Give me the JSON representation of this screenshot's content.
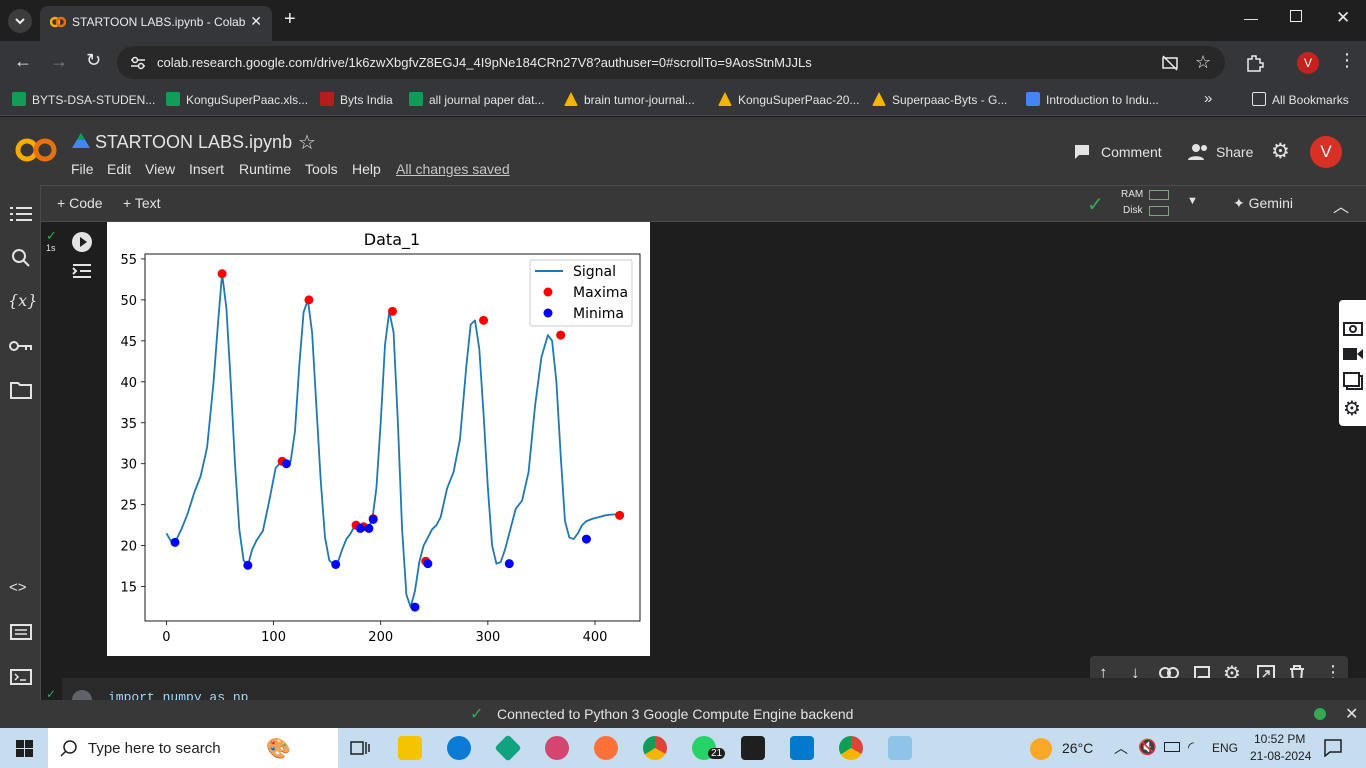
{
  "browser": {
    "tab_title": "STARTOON LABS.ipynb - Colab",
    "url": "colab.research.google.com/drive/1k6zwXbgfvZ8EGJ4_4I9pNe184CRn27V8?authuser=0#scrollTo=9AosStnMJJLs",
    "profile_initial": "V",
    "bookmarks": [
      {
        "label": "BYTS-DSA-STUDEN...",
        "color": "#0f9d58"
      },
      {
        "label": "KonguSuperPaac.xls...",
        "color": "#0f9d58"
      },
      {
        "label": "Byts India",
        "color": "#b71c1c"
      },
      {
        "label": "all journal paper dat...",
        "color": "#0f9d58"
      },
      {
        "label": "brain tumor-journal...",
        "color": "#f4b400"
      },
      {
        "label": "KonguSuperPaac-20...",
        "color": "#f4b400"
      },
      {
        "label": "Superpaac-Byts - G...",
        "color": "#f4b400"
      },
      {
        "label": "Introduction to Indu...",
        "color": "#4285f4"
      }
    ],
    "all_bookmarks": "All Bookmarks"
  },
  "colab": {
    "notebook_title": "STARTOON LABS.ipynb",
    "menu": [
      "File",
      "Edit",
      "View",
      "Insert",
      "Runtime",
      "Tools",
      "Help"
    ],
    "saved_status": "All changes saved",
    "comment": "Comment",
    "share": "Share",
    "avatar_initial": "V",
    "toolbar": {
      "code": "Code",
      "text": "Text",
      "ram": "RAM",
      "disk": "Disk",
      "gemini": "Gemini"
    },
    "cell_exec_time": "1s",
    "next_cell_code": "import numpy as np",
    "status_text": "Connected to Python 3 Google Compute Engine backend"
  },
  "chart_data": {
    "type": "line",
    "title": "Data_1",
    "xlabel": "",
    "ylabel": "",
    "xlim": [
      -20,
      442
    ],
    "ylim": [
      10.8,
      55.6
    ],
    "xticks": [
      0,
      100,
      200,
      300,
      400
    ],
    "yticks": [
      15,
      20,
      25,
      30,
      35,
      40,
      45,
      50,
      55
    ],
    "legend_position": "top-right",
    "series": [
      {
        "name": "Signal",
        "color": "#1f77b4",
        "kind": "line",
        "x": [
          0,
          4,
          8,
          14,
          20,
          26,
          32,
          38,
          44,
          48,
          52,
          56,
          60,
          64,
          68,
          72,
          76,
          80,
          84,
          90,
          96,
          102,
          108,
          112,
          116,
          120,
          124,
          128,
          132,
          136,
          140,
          144,
          148,
          152,
          156,
          160,
          164,
          168,
          172,
          176,
          180,
          184,
          188,
          192,
          196,
          200,
          204,
          208,
          212,
          216,
          220,
          224,
          228,
          232,
          236,
          240,
          244,
          248,
          252,
          256,
          262,
          268,
          274,
          280,
          284,
          288,
          292,
          296,
          300,
          304,
          308,
          312,
          316,
          320,
          326,
          332,
          338,
          344,
          350,
          356,
          360,
          364,
          368,
          372,
          376,
          380,
          384,
          388,
          392,
          398,
          404,
          410,
          416,
          422
        ],
        "y": [
          21.5,
          20.6,
          20.4,
          22.0,
          24.0,
          26.5,
          28.5,
          32.0,
          40.0,
          47.0,
          53.2,
          49.0,
          40.0,
          30.0,
          22.0,
          18.2,
          17.6,
          19.5,
          20.6,
          21.8,
          25.5,
          29.5,
          30.3,
          30.1,
          30.3,
          34.0,
          42.0,
          48.5,
          50.0,
          46.0,
          37.0,
          28.0,
          21.0,
          18.2,
          17.7,
          18.0,
          19.5,
          20.8,
          21.5,
          22.5,
          22.3,
          22.2,
          22.2,
          23.0,
          27.0,
          35.0,
          44.5,
          48.6,
          46.0,
          35.0,
          22.0,
          14.0,
          12.5,
          14.5,
          18.0,
          20.0,
          21.0,
          22.0,
          22.5,
          23.5,
          27.0,
          29.0,
          33.0,
          42.0,
          47.0,
          47.5,
          44.0,
          36.0,
          27.0,
          20.0,
          17.8,
          18.0,
          19.5,
          21.5,
          24.5,
          25.5,
          29.0,
          37.0,
          43.0,
          45.7,
          45.0,
          40.0,
          31.0,
          23.0,
          21.0,
          20.8,
          21.5,
          22.5,
          23.0,
          23.3,
          23.5,
          23.7,
          23.8,
          23.8
        ]
      },
      {
        "name": "Maxima",
        "color": "#ff0000",
        "kind": "scatter",
        "x": [
          52,
          108,
          133,
          177,
          184,
          193,
          211,
          242,
          296,
          368,
          423
        ],
        "y": [
          53.2,
          30.3,
          50.0,
          22.5,
          22.3,
          23.3,
          48.6,
          18.1,
          47.5,
          45.7,
          23.7
        ]
      },
      {
        "name": "Minima",
        "color": "#0000ff",
        "kind": "scatter",
        "x": [
          8,
          76,
          112,
          158,
          181,
          189,
          193,
          232,
          244,
          320,
          392
        ],
        "y": [
          20.4,
          17.6,
          30.0,
          17.7,
          22.1,
          22.1,
          23.2,
          12.5,
          17.8,
          17.8,
          20.8
        ]
      }
    ]
  },
  "taskbar": {
    "search_placeholder": "Type here to search",
    "weather": "26°C",
    "lang": "ENG",
    "time": "10:52 PM",
    "date": "21-08-2024",
    "whatsapp_badge": "21"
  }
}
